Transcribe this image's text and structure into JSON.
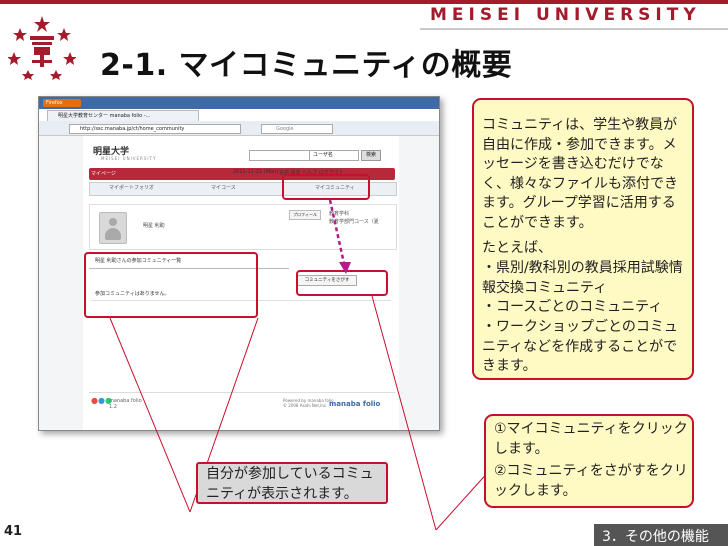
{
  "header": {
    "brand": "MEISEI UNIVERSITY",
    "slide_title": "2-1. マイコミュニティの概要"
  },
  "browser": {
    "menu_button": "Firefox",
    "tab_title": "明星大学教育センター manaba folio -...",
    "url": "http://ssc.manaba.jp/ct/home_community",
    "search_placeholder": "Google"
  },
  "site": {
    "school_name": "明星大学",
    "school_sub": "MEISEI UNIVERSITY",
    "user_select": "ユーザ名",
    "search_button": "検索",
    "mypage_tab": "マイページ",
    "date": "2011-11-21 (Mon)",
    "top_menu": "言語 設定 ヘルプ ログアウト",
    "tabs": [
      "マイポートフォリオ",
      "マイコース",
      "マイコミュニティ"
    ],
    "username": "明星 利助",
    "profile_button": "プロフィール",
    "course_line1": "教育学科",
    "course_line2": "教育学部門コース（夏",
    "list_title": "明星 利助さんの参加コミュニティ一覧",
    "find_button": "コミュニティをさがす",
    "empty_message": "参加コミュニティはありません。",
    "footer_brand": "manaba folio",
    "footer_version": "1.2",
    "powered_by": "Powered by manaba folio",
    "copyright": "© 2008 Asahi Net,Inc.",
    "footer_logo": "manaba folio"
  },
  "callout_main": {
    "paragraph1": "コミュニティは、学生や教員が自由に作成・参加できます。メッセージを書き込むだけでなく、様々なファイルも添付できます。グループ学習に活用することができます。",
    "intro": "たとえば、",
    "items": [
      "・県別/教科別の教員採用試験情報交換コミュニティ",
      "・コースごとのコミュニティ",
      "・ワークショップごとのコミュニティなどを作成することができます。"
    ]
  },
  "callout_steps": {
    "step1": "①マイコミュニティをクリックします。",
    "step2": "②コミュニティをさがすをクリックします。"
  },
  "note_box": {
    "text": "自分が参加しているコミュニティが表示されます。"
  },
  "footer": {
    "page_number": "41",
    "section_label": "3．その他の機能"
  },
  "colors": {
    "accent_red": "#c8102e",
    "brand_red": "#a41c2b",
    "callout_bg": "#fff9c4"
  }
}
